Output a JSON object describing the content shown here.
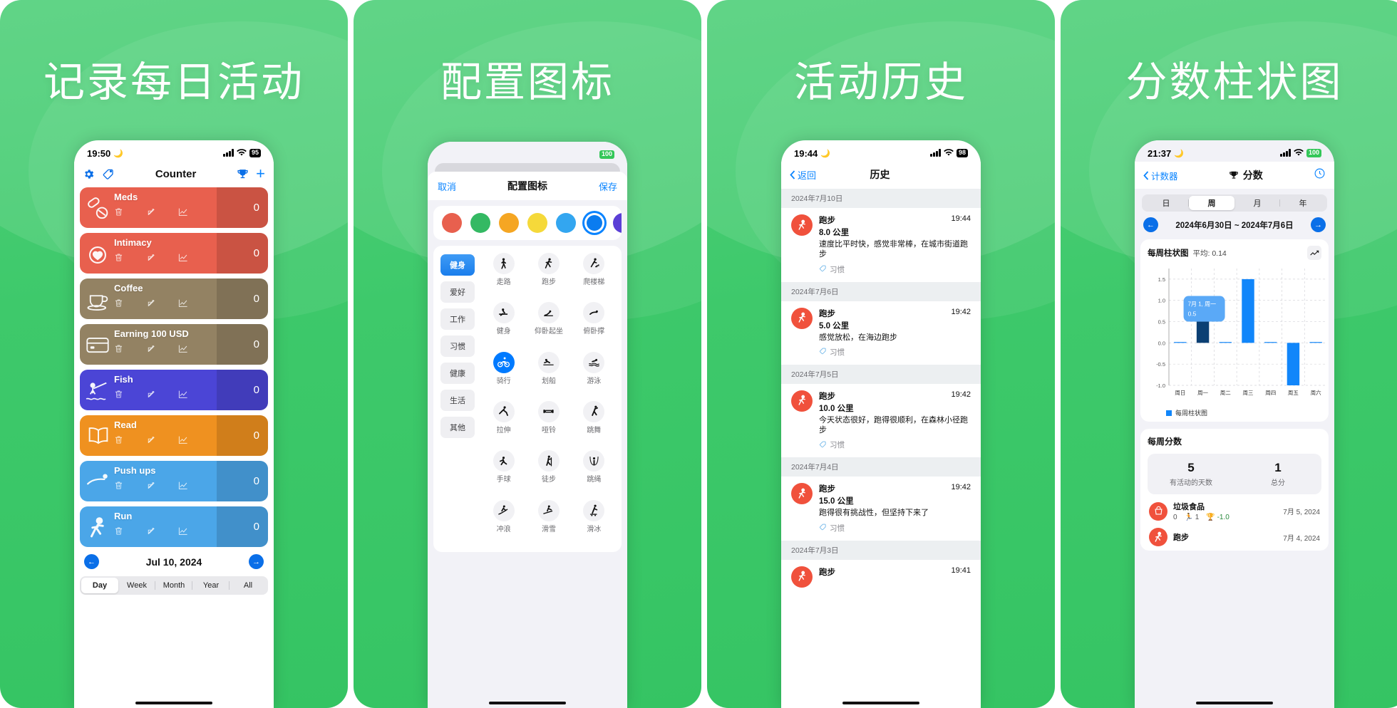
{
  "panels": [
    {
      "headline": "记录每日活动",
      "status": {
        "time": "19:50",
        "battery": "95",
        "battery_style": "dark"
      },
      "nav": {
        "title": "Counter",
        "gear": "gear-icon",
        "tag": "tag-icon",
        "trophy": "trophy-icon",
        "add": "+"
      },
      "counters": [
        {
          "name": "Meds",
          "value": "0",
          "color": "#e8604e",
          "icon": "pills-icon"
        },
        {
          "name": "Intimacy",
          "value": "0",
          "color": "#e8604e",
          "icon": "heart-icon"
        },
        {
          "name": "Coffee",
          "value": "0",
          "color": "#938263",
          "icon": "coffee-icon"
        },
        {
          "name": "Earning 100 USD",
          "value": "0",
          "color": "#938263",
          "icon": "card-icon"
        },
        {
          "name": "Fish",
          "value": "0",
          "color": "#4b45d6",
          "icon": "fishing-icon"
        },
        {
          "name": "Read",
          "value": "0",
          "color": "#ef9120",
          "icon": "book-icon"
        },
        {
          "name": "Push ups",
          "value": "0",
          "color": "#4ba6e8",
          "icon": "pushup-icon"
        },
        {
          "name": "Run",
          "value": "0",
          "color": "#4ba6e8",
          "icon": "run-icon"
        }
      ],
      "date": "Jul 10, 2024",
      "segments": [
        "Day",
        "Week",
        "Month",
        "Year",
        "All"
      ],
      "segment_active": "Day"
    },
    {
      "headline": "配置图标",
      "status": {
        "battery": "100",
        "battery_style": "green"
      },
      "nav": {
        "cancel": "取消",
        "title": "配置图标",
        "save": "保存"
      },
      "colors": [
        "#e8604e",
        "#34b963",
        "#f5a623",
        "#f5d93a",
        "#33a6f0",
        "#0a7cf0",
        "#5b3fd6"
      ],
      "color_selected_index": 5,
      "categories": [
        "健身",
        "爱好",
        "工作",
        "习惯",
        "健康",
        "生活",
        "其他"
      ],
      "category_active": "健身",
      "icons": [
        {
          "label": "走路",
          "glyph": "walk"
        },
        {
          "label": "跑步",
          "glyph": "run"
        },
        {
          "label": "爬楼梯",
          "glyph": "stairs"
        },
        {
          "label": "健身",
          "glyph": "gym"
        },
        {
          "label": "仰卧起坐",
          "glyph": "situp"
        },
        {
          "label": "俯卧撑",
          "glyph": "pushup"
        },
        {
          "label": "骑行",
          "glyph": "bike",
          "selected": true
        },
        {
          "label": "划船",
          "glyph": "row"
        },
        {
          "label": "游泳",
          "glyph": "swim"
        },
        {
          "label": "拉伸",
          "glyph": "stretch"
        },
        {
          "label": "哑铃",
          "glyph": "dumbbell"
        },
        {
          "label": "跳舞",
          "glyph": "dance"
        },
        {
          "label": "手球",
          "glyph": "handball"
        },
        {
          "label": "徒步",
          "glyph": "hike"
        },
        {
          "label": "跳绳",
          "glyph": "jumprope"
        },
        {
          "label": "冲浪",
          "glyph": "surf"
        },
        {
          "label": "滑雪",
          "glyph": "ski"
        },
        {
          "label": "滑冰",
          "glyph": "skate"
        }
      ]
    },
    {
      "headline": "活动历史",
      "status": {
        "time": "19:44",
        "battery": "98",
        "battery_style": "dark"
      },
      "nav": {
        "back": "返回",
        "title": "历史"
      },
      "history": [
        {
          "date": "2024年7月10日",
          "entries": [
            {
              "name": "跑步",
              "time": "19:44",
              "distance": "8.0 公里",
              "note": "速度比平时快，感觉非常棒，在城市街道跑步",
              "tag": "习惯"
            }
          ]
        },
        {
          "date": "2024年7月6日",
          "entries": [
            {
              "name": "跑步",
              "time": "19:42",
              "distance": "5.0 公里",
              "note": "感觉放松，在海边跑步",
              "tag": "习惯"
            }
          ]
        },
        {
          "date": "2024年7月5日",
          "entries": [
            {
              "name": "跑步",
              "time": "19:42",
              "distance": "10.0 公里",
              "note": "今天状态很好，跑得很顺利，在森林小径跑步",
              "tag": "习惯"
            }
          ]
        },
        {
          "date": "2024年7月4日",
          "entries": [
            {
              "name": "跑步",
              "time": "19:42",
              "distance": "15.0 公里",
              "note": "跑得很有挑战性，但坚持下来了",
              "tag": "习惯"
            }
          ]
        },
        {
          "date": "2024年7月3日",
          "entries": [
            {
              "name": "跑步",
              "time": "19:41",
              "distance": "",
              "note": "",
              "tag": ""
            }
          ]
        }
      ]
    },
    {
      "headline": "分数柱状图",
      "status": {
        "time": "21:37",
        "battery": "100",
        "battery_style": "green"
      },
      "nav": {
        "back": "计数器",
        "title": "分数",
        "trophy": "trophy-icon",
        "clock": "clock-icon"
      },
      "segments": [
        "日",
        "周",
        "月",
        "年"
      ],
      "segment_active": "周",
      "range": "2024年6月30日 ~ 2024年7月6日",
      "chart_card": {
        "title": "每周柱状图",
        "average_label": "平均: 0.14"
      },
      "scores_card": {
        "title": "每周分数",
        "stats": [
          {
            "value": "5",
            "label": "有活动的天数"
          },
          {
            "value": "1",
            "label": "总分"
          }
        ],
        "rows": [
          {
            "name": "垃圾食品",
            "count": "0",
            "metric": "1",
            "score": "-1.0",
            "date": "7月 5, 2024",
            "color": "#f0513c"
          },
          {
            "name": "跑步",
            "count": "",
            "metric": "",
            "score": "",
            "date": "7月 4, 2024",
            "color": "#f0513c"
          }
        ]
      },
      "chart_data": {
        "type": "bar",
        "title": "每周柱状图",
        "categories": [
          "周日",
          "周一",
          "周二",
          "周三",
          "周四",
          "周五",
          "周六"
        ],
        "values": [
          0,
          0.5,
          0,
          1.5,
          0,
          -1.0,
          0
        ],
        "series": [
          {
            "name": "每周柱状图",
            "values": [
              0,
              0.5,
              0,
              1.5,
              0,
              -1.0,
              0
            ]
          }
        ],
        "ylim": [
          -1.0,
          1.75
        ],
        "yticks": [
          -1.0,
          -0.5,
          0.0,
          0.5,
          1.0,
          1.5
        ],
        "ytick_labels": [
          "-1.0",
          "-0.5",
          "0.0",
          "0.5",
          "1.0",
          "1.5"
        ],
        "xlabel": "",
        "ylabel": "",
        "grid": true,
        "legend": "每周柱状图",
        "legend_position": "bottom-left",
        "bar_color": "#1186fa",
        "highlight_index": 1,
        "highlight_color": "#0b3f73",
        "tooltip": {
          "label": "7月 1, 周一",
          "value": "0.5"
        },
        "average": 0.14
      }
    }
  ]
}
